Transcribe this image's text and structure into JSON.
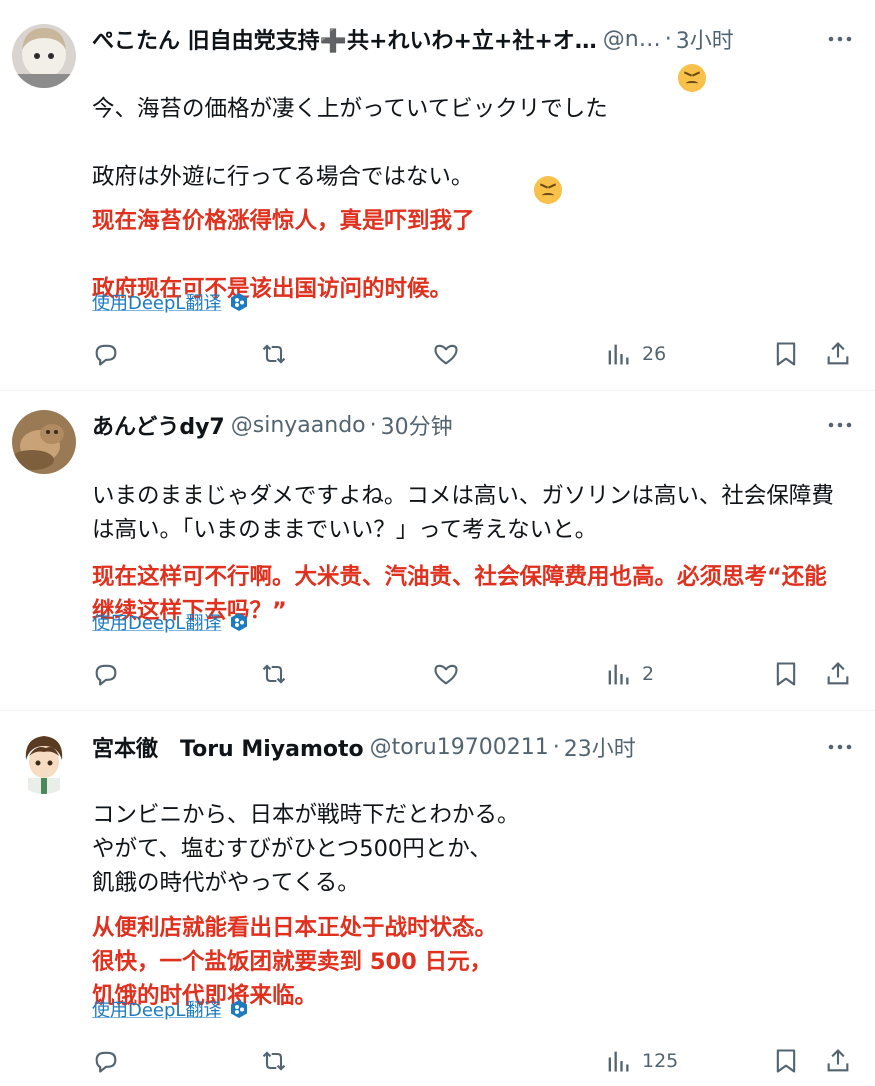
{
  "tweets": [
    {
      "name": "ぺこたん 旧自由党支持➕共+れいわ+立+社+オ…",
      "handle": "@n…",
      "sep": "·",
      "time": "3小时",
      "body_ja": "今、海苔の価格が凄く上がっていてビックリでした\n\n政府は外遊に行ってる場合ではない。",
      "body_zh": "现在海苔价格涨得惊人，真是吓到我了\n\n政府现在可不是该出国访问的时候。",
      "translate": "使用DeepL翻译",
      "views": "26"
    },
    {
      "name": "あんどうdy7",
      "handle": "@sinyaando",
      "sep": "·",
      "time": "30分钟",
      "body_ja": "いまのままじゃダメですよね。コメは高い、ガソリンは高い、社会保障費は高い。「いまのままでいい？」って考えないと。",
      "body_zh": "现在这样可不行啊。大米贵、汽油贵、社会保障费用也高。必须思考“还能继续这样下去吗？”",
      "translate": "使用DeepL翻译",
      "views": "2"
    },
    {
      "name": "宮本徹　Toru Miyamoto",
      "handle": "@toru19700211",
      "sep": "·",
      "time": "23小时",
      "body_ja": "コンビニから、日本が戦時下だとわかる。\nやがて、塩むすびがひとつ500円とか、\n飢餓の時代がやってくる。",
      "body_zh": "从便利店就能看出日本正处于战时状态。\n很快，一个盐饭团就要卖到 500 日元，\n饥饿的时代即将来临。",
      "translate": "使用DeepL翻译",
      "views": "125"
    }
  ],
  "colors": {
    "accent": "#1d9bf0",
    "translation_text": "#e0301e",
    "muted": "#536471"
  },
  "icons": [
    "reply-icon",
    "retweet-icon",
    "like-icon",
    "views-icon",
    "bookmark-icon",
    "share-icon",
    "more-icon",
    "deepl-icon",
    "persevering-face-emoji"
  ]
}
